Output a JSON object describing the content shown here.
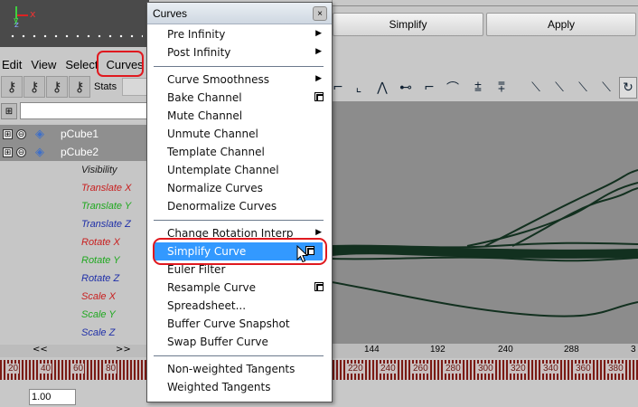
{
  "viewport": {
    "axis_x": "x",
    "axis_y": "y",
    "axis_z": "z"
  },
  "topstrip": {
    "simplify_label": "Simplify",
    "apply_label": "Apply"
  },
  "menubar": {
    "items": [
      "Edit",
      "View",
      "Select",
      "Curves"
    ]
  },
  "toolbar": {
    "stats_label": "Stats"
  },
  "outliner": {
    "objects": [
      {
        "name": "pCube1",
        "expand": "⊞",
        "collapse": "⊖"
      },
      {
        "name": "pCube2",
        "expand": "⊞",
        "collapse": "⊖"
      }
    ],
    "attributes": [
      {
        "label": "Visibility",
        "color": "#1a1a1a"
      },
      {
        "label": "Translate X",
        "color": "#c81e1e"
      },
      {
        "label": "Translate Y",
        "color": "#1fa81f"
      },
      {
        "label": "Translate Z",
        "color": "#1f2fa8"
      },
      {
        "label": "Rotate X",
        "color": "#c81e1e"
      },
      {
        "label": "Rotate Y",
        "color": "#1fa81f"
      },
      {
        "label": "Rotate Z",
        "color": "#1f2fa8"
      },
      {
        "label": "Scale X",
        "color": "#c81e1e"
      },
      {
        "label": "Scale Y",
        "color": "#1fa81f"
      },
      {
        "label": "Scale Z",
        "color": "#1f2fa8"
      }
    ],
    "nav_prev": "<<",
    "nav_next": ">>"
  },
  "ruler": {
    "ticks": [
      "144",
      "192",
      "240",
      "288",
      "3"
    ]
  },
  "timeline": {
    "labels": [
      "20",
      "40",
      "60",
      "80",
      "220",
      "240",
      "260",
      "280",
      "300",
      "320",
      "340",
      "360",
      "380"
    ]
  },
  "bottom": {
    "value": "1.00"
  },
  "popup": {
    "title": "Curves",
    "close": "×",
    "groups": [
      [
        {
          "label": "Pre Infinity",
          "submenu": true
        },
        {
          "label": "Post Infinity",
          "submenu": true
        }
      ],
      [
        {
          "label": "Curve Smoothness",
          "submenu": true
        },
        {
          "label": "Bake Channel",
          "option": true
        },
        {
          "label": "Mute Channel"
        },
        {
          "label": "Unmute Channel"
        },
        {
          "label": "Template Channel"
        },
        {
          "label": "Untemplate Channel"
        },
        {
          "label": "Normalize Curves"
        },
        {
          "label": "Denormalize Curves"
        }
      ],
      [
        {
          "label": "Change Rotation Interp",
          "submenu": true
        },
        {
          "label": "Simplify Curve",
          "option": true,
          "highlighted": true
        },
        {
          "label": "Euler Filter"
        },
        {
          "label": "Resample Curve",
          "option": true
        },
        {
          "label": "Spreadsheet..."
        },
        {
          "label": "Buffer Curve Snapshot"
        },
        {
          "label": "Swap Buffer Curve"
        }
      ],
      [
        {
          "label": "Non-weighted Tangents"
        },
        {
          "label": "Weighted Tangents"
        }
      ]
    ]
  }
}
